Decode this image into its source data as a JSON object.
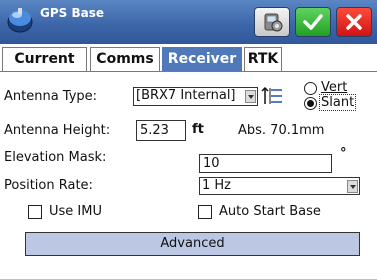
{
  "window": {
    "title": "GPS Base",
    "app_icon": "gps-base-icon",
    "buttons": {
      "settings_icon": "gear-device-icon",
      "ok_icon": "check-icon",
      "close_icon": "close-icon"
    },
    "colors": {
      "titlebar": "#3d67a9",
      "ok": "#22a024",
      "close": "#cf1414"
    }
  },
  "tabs": [
    {
      "label": "Current",
      "active": false
    },
    {
      "label": "Comms",
      "active": false
    },
    {
      "label": "Receiver",
      "active": true
    },
    {
      "label": "RTK",
      "active": false
    }
  ],
  "receiver": {
    "antenna_type": {
      "label": "Antenna Type:",
      "value": "[BRX7 Internal]"
    },
    "measure_mode": {
      "options": [
        {
          "label": "Vert",
          "selected": false
        },
        {
          "label": "Slant",
          "selected": true
        }
      ]
    },
    "antenna_height": {
      "label": "Antenna Height:",
      "value": "5.23",
      "unit": "ft",
      "absolute": "Abs. 70.1mm"
    },
    "elevation_mask": {
      "label": "Elevation Mask:",
      "value": "10",
      "unit": "°"
    },
    "position_rate": {
      "label": "Position Rate:",
      "value": "1 Hz"
    },
    "use_imu": {
      "label": "Use IMU",
      "checked": false
    },
    "auto_start_base": {
      "label": "Auto Start Base",
      "checked": false
    },
    "advanced_label": "Advanced"
  }
}
